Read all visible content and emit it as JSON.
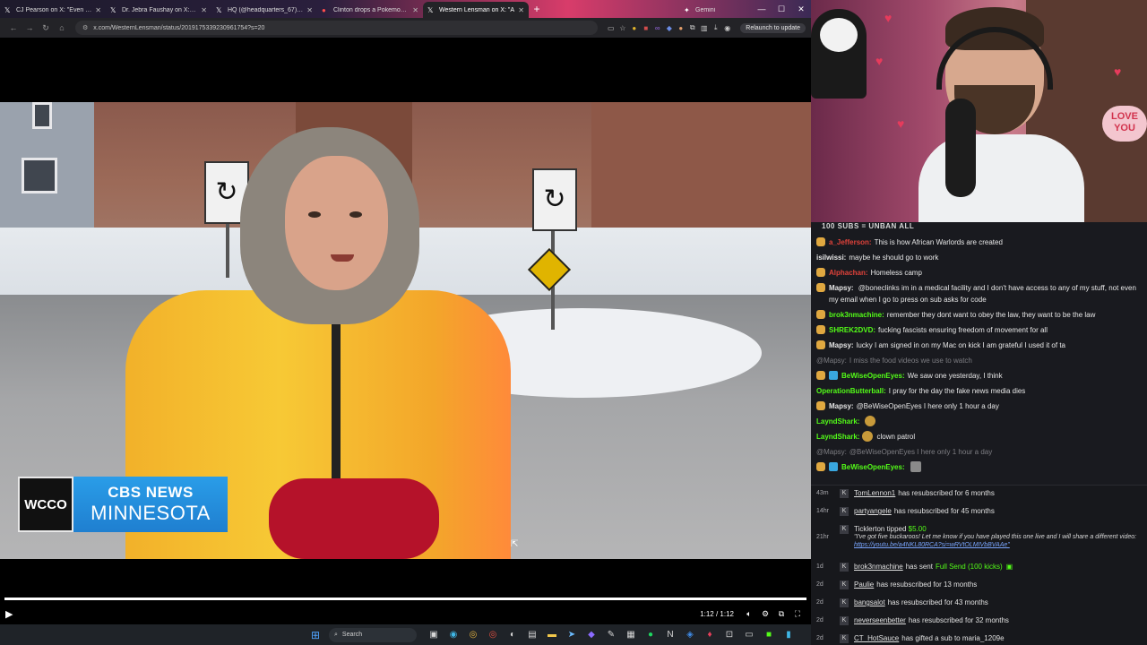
{
  "browser": {
    "tabs": [
      {
        "icon": "𝕏",
        "title": "CJ Pearson on X: \"Even CN",
        "active": false
      },
      {
        "icon": "𝕏",
        "title": "Dr. Jebra Faushay on X: \"So",
        "active": false
      },
      {
        "icon": "𝕏",
        "title": "HQ (@headquarters_67) / X",
        "active": false
      },
      {
        "icon": "●",
        "title": "Clinton drops a Pokemon Go",
        "active": false
      },
      {
        "icon": "𝕏",
        "title": "Western Lensman on X: \"A",
        "active": true
      }
    ],
    "gemini_tab": "Gemini",
    "url": "x.com/WesternLensman/status/2019175339230961754?s=20",
    "relaunch_label": "Relaunch to update"
  },
  "video": {
    "timecode": "1:12 / 1:12",
    "progress": 1.0,
    "chyron_station": "WCCO",
    "chyron_line1": "CBS NEWS",
    "chyron_line2": "MINNESOTA"
  },
  "taskbar": {
    "search_label": "Search"
  },
  "webcam": {
    "love_sign": "LOVE YOU"
  },
  "chat": {
    "header": "100 SUBS = UNBAN ALL",
    "messages": [
      {
        "user": "a_Jefferson:",
        "text": "This is how African Warlords are created",
        "color": "#e0423a",
        "dim": false
      },
      {
        "user": "isilwissi:",
        "text": "maybe he should go to work",
        "color": "#e6e6e6",
        "dim": false
      },
      {
        "user": "Alphachan:",
        "text": "Homeless camp",
        "color": "#e0423a",
        "dim": false
      },
      {
        "user": "Mapsy:",
        "text": "@boneclinks im in a medical facility and I don't have access to any of my stuff, not even my email when I go to press on sub asks for code",
        "color": "#e6e6e6",
        "dim": false
      },
      {
        "user": "brok3nmachine:",
        "text": "remember they dont want to obey the law, they want to be the law",
        "color": "#53fc18",
        "dim": false
      },
      {
        "user": "SHREK2DVD:",
        "text": "fucking fascists ensuring freedom of movement for all",
        "color": "#53fc18",
        "dim": false
      },
      {
        "user": "Mapsy:",
        "text": "lucky I am signed in on my Mac on kick I am grateful I used it of ta",
        "color": "#e6e6e6",
        "dim": false
      },
      {
        "user": "@Mapsy:",
        "text": "I miss the food videos we use to watch",
        "color": "#7d7d82",
        "dim": true
      },
      {
        "user": "BeWiseOpenEyes:",
        "text": "We saw one yesterday, I think",
        "color": "#53fc18",
        "dim": false
      },
      {
        "user": "OperationButterball:",
        "text": "I pray for the day the fake news media dies",
        "color": "#53fc18",
        "dim": false
      },
      {
        "user": "Mapsy:",
        "text": "@BeWiseOpenEyes I here only 1 hour a day",
        "color": "#e6e6e6",
        "dim": false
      },
      {
        "user": "LayndShark:",
        "text": "",
        "color": "#53fc18",
        "dim": false
      },
      {
        "user": "LayndShark:",
        "text": "clown patrol",
        "color": "#53fc18",
        "dim": false
      },
      {
        "user": "@Mapsy:",
        "text": "@BeWiseOpenEyes I here only 1 hour a day",
        "color": "#7d7d82",
        "dim": true
      },
      {
        "user": "BeWiseOpenEyes:",
        "text": "",
        "color": "#53fc18",
        "dim": false
      }
    ],
    "events": [
      {
        "when": "43m",
        "name": "TomLennon1",
        "text": "has resubscribed for 6 months"
      },
      {
        "when": "14hr",
        "name": "partyangele",
        "text": "has resubscribed for 45 months"
      },
      {
        "when": "21hr",
        "name": "Ticklerton",
        "text": "tipped",
        "amount": "$5.00",
        "message": "\"I've got five buckaroos! Let me know if you have played this one live and I will share a different video:",
        "link": "https://youtu.be/a4NKL80RCA?si=wRVtOLMIVbBVAAe\""
      },
      {
        "when": "1d",
        "name": "brok3nmachine",
        "text": "has sent",
        "extra": "Full Send (100 kicks)"
      },
      {
        "when": "2d",
        "name": "Paulie",
        "text": "has resubscribed for 13 months"
      },
      {
        "when": "2d",
        "name": "bangsalot",
        "text": "has resubscribed for 43 months"
      },
      {
        "when": "2d",
        "name": "neverseenbetter",
        "text": "has resubscribed for 32 months"
      },
      {
        "when": "2d",
        "name": "CT_HotSauce",
        "text": "has gifted a sub to maria_1209e"
      }
    ]
  }
}
